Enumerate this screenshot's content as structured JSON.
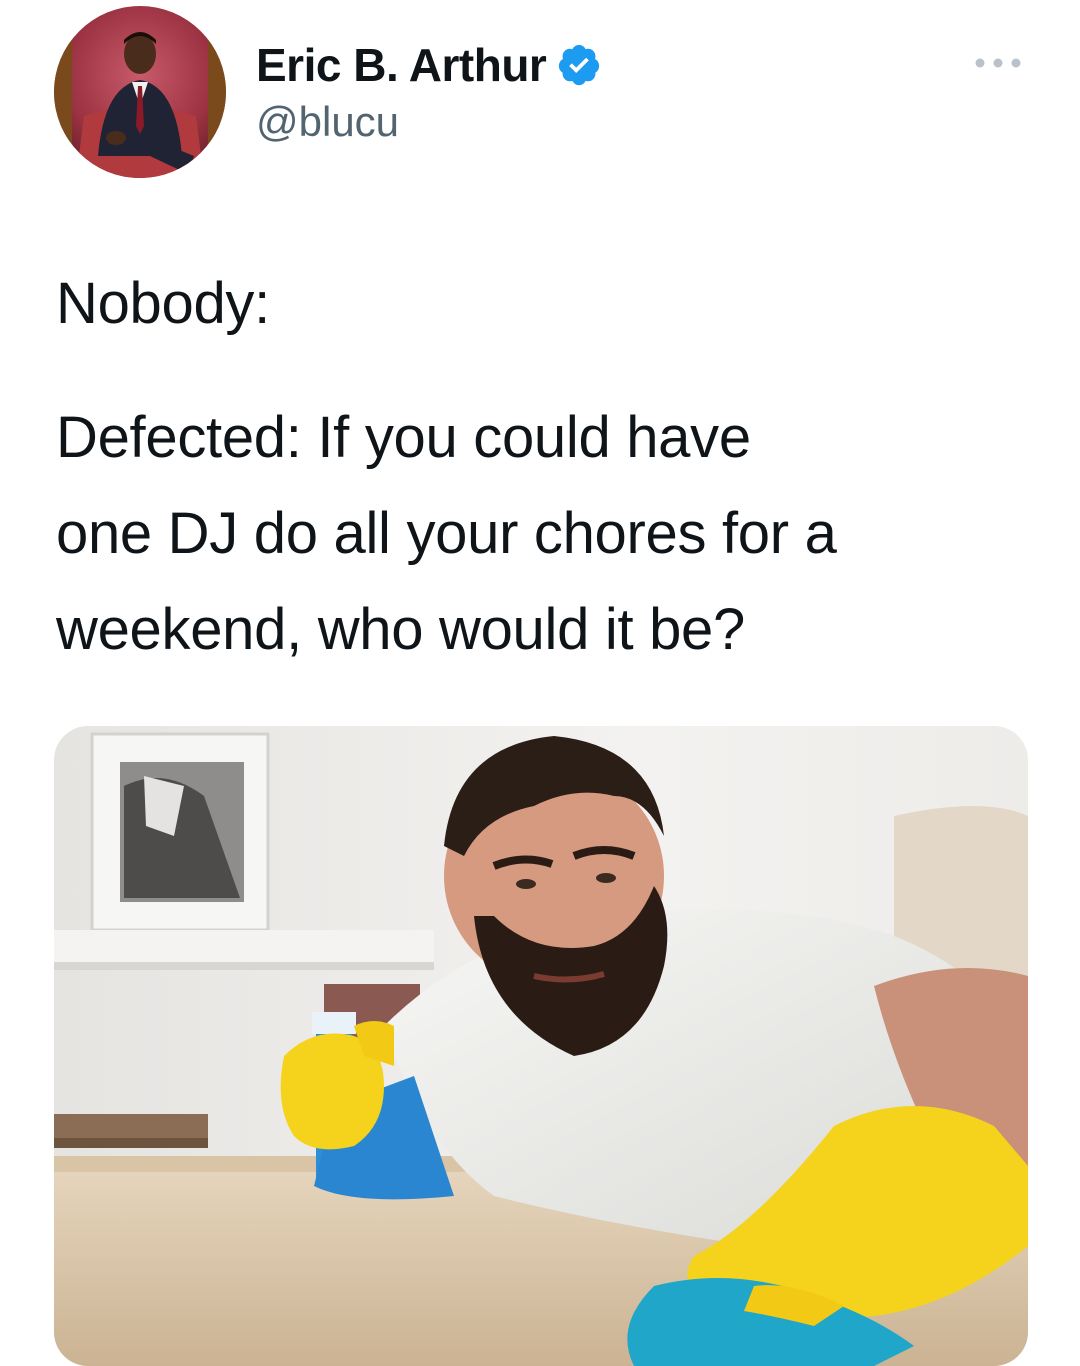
{
  "tweet": {
    "author": {
      "display_name": "Eric B. Arthur",
      "handle": "@blucu",
      "verified": true,
      "avatar_icon": "profile-photo"
    },
    "more_icon": "more-options-icon",
    "text_lines": {
      "nobody": "Nobody:",
      "question_line_1": "Defected: If you could have",
      "question_line_2": "one DJ do all your chores for a",
      "question_line_3": "weekend, who would it be?"
    },
    "media": {
      "type": "photo"
    }
  },
  "colors": {
    "text": "#0f1419",
    "secondary_text": "#536471",
    "verified_blue": "#1d9bf0",
    "glove_yellow": "#f5d31c",
    "cloth_blue": "#1fa6c9"
  }
}
